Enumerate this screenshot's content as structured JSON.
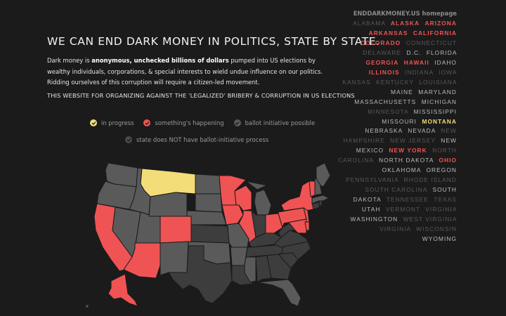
{
  "header": {
    "title": "WE CAN END DARK MONEY IN POLITICS, STATE BY STATE.",
    "intro_before": "Dark money is ",
    "intro_bold": "anonymous, unchecked billions of dollars",
    "intro_after": " pumped into US elections by wealthy individuals, corporations, & special interests to wield undue influence on our politics. Ridding ourselves of this corruption will require a citizen-led movement.",
    "subline": "THIS WEBSITE FOR ORGANIZING AGAINST THE 'LEGALIZED' BRIBERY & CORRUPTION IN US ELECTIONS"
  },
  "legend": {
    "in_progress": "in progress",
    "happening": "something's happening",
    "possible": "ballot initiative possible",
    "not_possible": "state does NOT have ballot-initiative process"
  },
  "colors": {
    "background": "#1b1b1b",
    "in_progress": "#f2dd78",
    "happening": "#f05353",
    "possible": "#5a5a5a",
    "not_possible": "#3d3d3d",
    "state_text_possible": "#bbbbbb",
    "state_text_not_possible": "#585858"
  },
  "nav": {
    "home_link": "ENDDARKMONEY.US homepage"
  },
  "states": [
    {
      "name": "Alabama",
      "status": "no"
    },
    {
      "name": "Alaska",
      "status": "active"
    },
    {
      "name": "Arizona",
      "status": "active"
    },
    {
      "name": "Arkansas",
      "status": "active"
    },
    {
      "name": "California",
      "status": "active"
    },
    {
      "name": "Colorado",
      "status": "active"
    },
    {
      "name": "Connecticut",
      "status": "no"
    },
    {
      "name": "Delaware",
      "status": "no"
    },
    {
      "name": "D.C.",
      "status": "possible"
    },
    {
      "name": "Florida",
      "status": "possible"
    },
    {
      "name": "Georgia",
      "status": "active"
    },
    {
      "name": "Hawaii",
      "status": "active"
    },
    {
      "name": "Idaho",
      "status": "possible"
    },
    {
      "name": "Illinois",
      "status": "active"
    },
    {
      "name": "Indiana",
      "status": "no"
    },
    {
      "name": "Iowa",
      "status": "no"
    },
    {
      "name": "Kansas",
      "status": "no"
    },
    {
      "name": "Kentucky",
      "status": "no"
    },
    {
      "name": "Louisiana",
      "status": "no"
    },
    {
      "name": "Maine",
      "status": "possible"
    },
    {
      "name": "Maryland",
      "status": "possible"
    },
    {
      "name": "Massachusetts",
      "status": "possible"
    },
    {
      "name": "Michigan",
      "status": "possible"
    },
    {
      "name": "Minnesota",
      "status": "no"
    },
    {
      "name": "Mississippi",
      "status": "possible"
    },
    {
      "name": "Missouri",
      "status": "possible"
    },
    {
      "name": "Montana",
      "status": "progress"
    },
    {
      "name": "Nebraska",
      "status": "possible"
    },
    {
      "name": "Nevada",
      "status": "possible"
    },
    {
      "name": "New Hampshire",
      "status": "no"
    },
    {
      "name": "New Jersey",
      "status": "no"
    },
    {
      "name": "New Mexico",
      "status": "possible"
    },
    {
      "name": "New York",
      "status": "active"
    },
    {
      "name": "North Carolina",
      "status": "no"
    },
    {
      "name": "North Dakota",
      "status": "possible"
    },
    {
      "name": "Ohio",
      "status": "active"
    },
    {
      "name": "Oklahoma",
      "status": "possible"
    },
    {
      "name": "Oregon",
      "status": "possible"
    },
    {
      "name": "Pennsylvania",
      "status": "no"
    },
    {
      "name": "Rhode Island",
      "status": "no"
    },
    {
      "name": "South Carolina",
      "status": "no"
    },
    {
      "name": "South Dakota",
      "status": "possible"
    },
    {
      "name": "Tennessee",
      "status": "no"
    },
    {
      "name": "Texas",
      "status": "no"
    },
    {
      "name": "Utah",
      "status": "possible"
    },
    {
      "name": "Vermont",
      "status": "no"
    },
    {
      "name": "Virginia",
      "status": "no"
    },
    {
      "name": "Washington",
      "status": "possible"
    },
    {
      "name": "West Virginia",
      "status": "no"
    },
    {
      "name": "Virginia",
      "status": "no"
    },
    {
      "name": "Wisconsin",
      "status": "no"
    },
    {
      "name": "Wyoming",
      "status": "possible"
    }
  ],
  "map_states": [
    {
      "id": "WA",
      "status": "possible"
    },
    {
      "id": "OR",
      "status": "possible"
    },
    {
      "id": "CA",
      "status": "active"
    },
    {
      "id": "NV",
      "status": "possible"
    },
    {
      "id": "ID",
      "status": "possible"
    },
    {
      "id": "MT",
      "status": "progress"
    },
    {
      "id": "WY",
      "status": "possible"
    },
    {
      "id": "UT",
      "status": "possible"
    },
    {
      "id": "AZ",
      "status": "active"
    },
    {
      "id": "CO",
      "status": "active"
    },
    {
      "id": "NM",
      "status": "possible"
    },
    {
      "id": "ND",
      "status": "possible"
    },
    {
      "id": "SD",
      "status": "possible"
    },
    {
      "id": "NE",
      "status": "possible"
    },
    {
      "id": "KS",
      "status": "no"
    },
    {
      "id": "OK",
      "status": "possible"
    },
    {
      "id": "TX",
      "status": "no"
    },
    {
      "id": "MN",
      "status": "active"
    },
    {
      "id": "IA",
      "status": "active"
    },
    {
      "id": "MO",
      "status": "possible"
    },
    {
      "id": "AR",
      "status": "possible"
    },
    {
      "id": "LA",
      "status": "no"
    },
    {
      "id": "WI",
      "status": "active"
    },
    {
      "id": "IL",
      "status": "active"
    },
    {
      "id": "MI",
      "status": "possible"
    },
    {
      "id": "IN",
      "status": "no"
    },
    {
      "id": "OH",
      "status": "active"
    },
    {
      "id": "KY",
      "status": "no"
    },
    {
      "id": "TN",
      "status": "no"
    },
    {
      "id": "MS",
      "status": "possible"
    },
    {
      "id": "AL",
      "status": "no"
    },
    {
      "id": "GA",
      "status": "no"
    },
    {
      "id": "FL",
      "status": "possible"
    },
    {
      "id": "SC",
      "status": "no"
    },
    {
      "id": "NC",
      "status": "no"
    },
    {
      "id": "VA",
      "status": "no"
    },
    {
      "id": "WV",
      "status": "no"
    },
    {
      "id": "PA",
      "status": "active"
    },
    {
      "id": "NY",
      "status": "active"
    },
    {
      "id": "NJ",
      "status": "active"
    },
    {
      "id": "MD",
      "status": "active"
    },
    {
      "id": "DE",
      "status": "active"
    },
    {
      "id": "CT",
      "status": "no"
    },
    {
      "id": "RI",
      "status": "no"
    },
    {
      "id": "MA",
      "status": "possible"
    },
    {
      "id": "VT",
      "status": "active"
    },
    {
      "id": "NH",
      "status": "possible"
    },
    {
      "id": "ME",
      "status": "possible"
    },
    {
      "id": "AK",
      "status": "active"
    }
  ]
}
